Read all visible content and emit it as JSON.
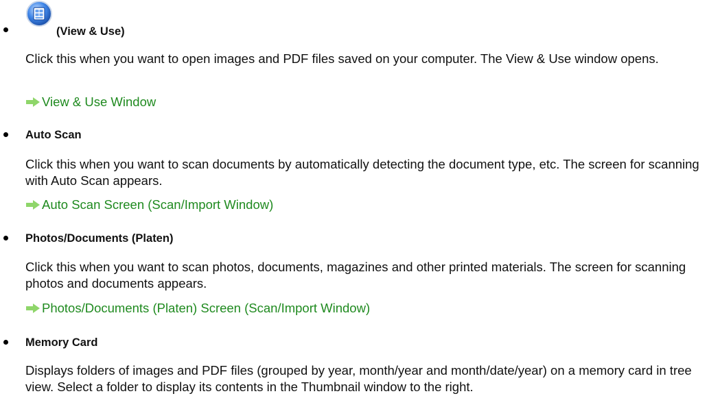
{
  "colors": {
    "link": "#1f8a1f",
    "arrow": "#8fd66a",
    "icon_blue": "#2f6fd6"
  },
  "items": [
    {
      "icon": "view-use-icon",
      "title": "(View & Use)",
      "description": "Click this when you want to open images and PDF files saved on your computer. The View & Use window opens.",
      "link": "View & Use Window"
    },
    {
      "title": "Auto Scan",
      "description": "Click this when you want to scan documents by automatically detecting the document type, etc. The screen for scanning with Auto Scan appears.",
      "link": "Auto Scan Screen (Scan/Import Window)"
    },
    {
      "title": "Photos/Documents (Platen)",
      "description": "Click this when you want to scan photos, documents, magazines and other printed materials. The screen for scanning photos and documents appears.",
      "link": "Photos/Documents (Platen) Screen (Scan/Import Window)"
    },
    {
      "title": "Memory Card",
      "description": "Displays folders of images and PDF files (grouped by year, month/year and month/date/year) on a memory card in tree view. Select a folder to display its contents in the Thumbnail window to the right."
    }
  ]
}
